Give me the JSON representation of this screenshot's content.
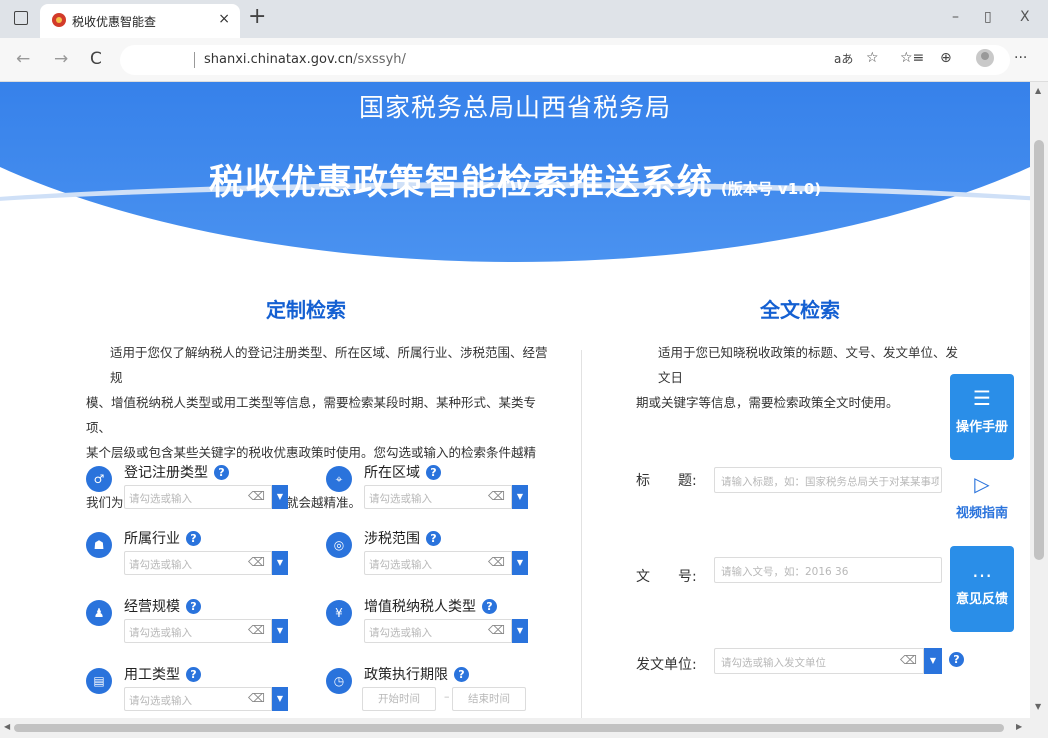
{
  "browser": {
    "tab_title": "税收优惠智能查",
    "tab_close": "×",
    "new_tab": "+",
    "minimize": "–",
    "restore": "▯",
    "close": "X",
    "back": "←",
    "forward": "→",
    "refresh": "C",
    "url_host": "shanxi.chinatax.gov.cn",
    "url_path": "/sxssyh/",
    "read_aloud": "aあ",
    "favorite": "☆",
    "favorites_list": "☆≡",
    "collections": "⊕",
    "more": "···"
  },
  "banner": {
    "org": "国家税务总局山西省税务局",
    "title": "税收优惠政策智能检索推送系统",
    "version": "(版本号 v1.0)"
  },
  "custom_search": {
    "title": "定制检索",
    "description_lines": [
      "适用于您仅了解纳税人的登记注册类型、所在区域、所属行业、涉税范围、经营规",
      "模、增值税纳税人类型或用工类型等信息，需要检索某段时期、某种形式、某类专项、",
      "某个层级或包含某些关键字的税收优惠政策时使用。您勾选或输入的检索条件越精细，",
      "我们为您匹配并推送的税收优惠政策就会越精准。"
    ],
    "fields": [
      {
        "label": "登记注册类型",
        "placeholder": "请勾选或输入",
        "icon": "♂"
      },
      {
        "label": "所在区域",
        "placeholder": "请勾选或输入",
        "icon": "⌖"
      },
      {
        "label": "所属行业",
        "placeholder": "请勾选或输入",
        "icon": "☗"
      },
      {
        "label": "涉税范围",
        "placeholder": "请勾选或输入",
        "icon": "◎"
      },
      {
        "label": "经营规模",
        "placeholder": "请勾选或输入",
        "icon": "♟"
      },
      {
        "label": "增值税纳税人类型",
        "placeholder": "请勾选或输入",
        "icon": "¥"
      },
      {
        "label": "用工类型",
        "placeholder": "请勾选或输入",
        "icon": "▤"
      },
      {
        "label": "政策执行期限",
        "start_placeholder": "开始时间",
        "end_placeholder": "结束时间",
        "icon": "◷"
      }
    ],
    "help_glyph": "?",
    "eraser_glyph": "⌫",
    "dropdown_glyph": "▼",
    "date_separator": "–"
  },
  "fulltext_search": {
    "title": "全文检索",
    "description_lines": [
      "适用于您已知晓税收政策的标题、文号、发文单位、发文日",
      "期或关键字等信息，需要检索政策全文时使用。"
    ],
    "title_label": "标　　题:",
    "title_placeholder": "请输入标题，如：国家税务总局关于对某某事项的",
    "docno_label": "文　　号:",
    "docno_placeholder": "请输入文号，如：2016 36",
    "unit_label": "发文单位:",
    "unit_placeholder": "请勾选或输入发文单位"
  },
  "side_tools": [
    {
      "label": "操作手册",
      "glyph": "☰"
    },
    {
      "label": "视频指南",
      "glyph": "▷"
    },
    {
      "label": "意见反馈",
      "glyph": "…"
    }
  ],
  "colors": {
    "accent": "#2a73dc",
    "title_blue": "#1460d2",
    "banner_blue": "#2f7be8",
    "side_blue": "#2a8ee8"
  }
}
